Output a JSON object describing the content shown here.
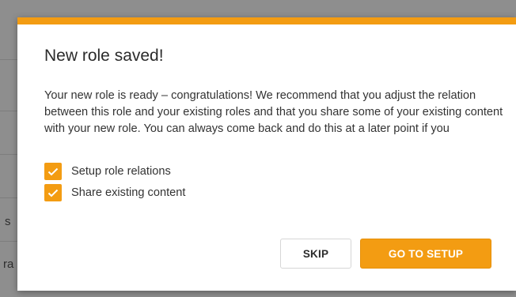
{
  "background": {
    "partial_text_1": "s",
    "partial_text_2": "ra"
  },
  "dialog": {
    "title": "New role saved!",
    "message": "Your new role is ready – congratulations! We recommend that you adjust the relation between this role and your existing roles and that you share some of your existing content with your new role. You can always come back and do this at a later point if you",
    "checkboxes": [
      {
        "label": "Setup role relations",
        "checked": true
      },
      {
        "label": "Share existing content",
        "checked": true
      }
    ],
    "skip_label": "SKIP",
    "setup_label": "GO TO SETUP"
  },
  "colors": {
    "accent": "#f39c12",
    "overlay": "#8e8e8e"
  }
}
